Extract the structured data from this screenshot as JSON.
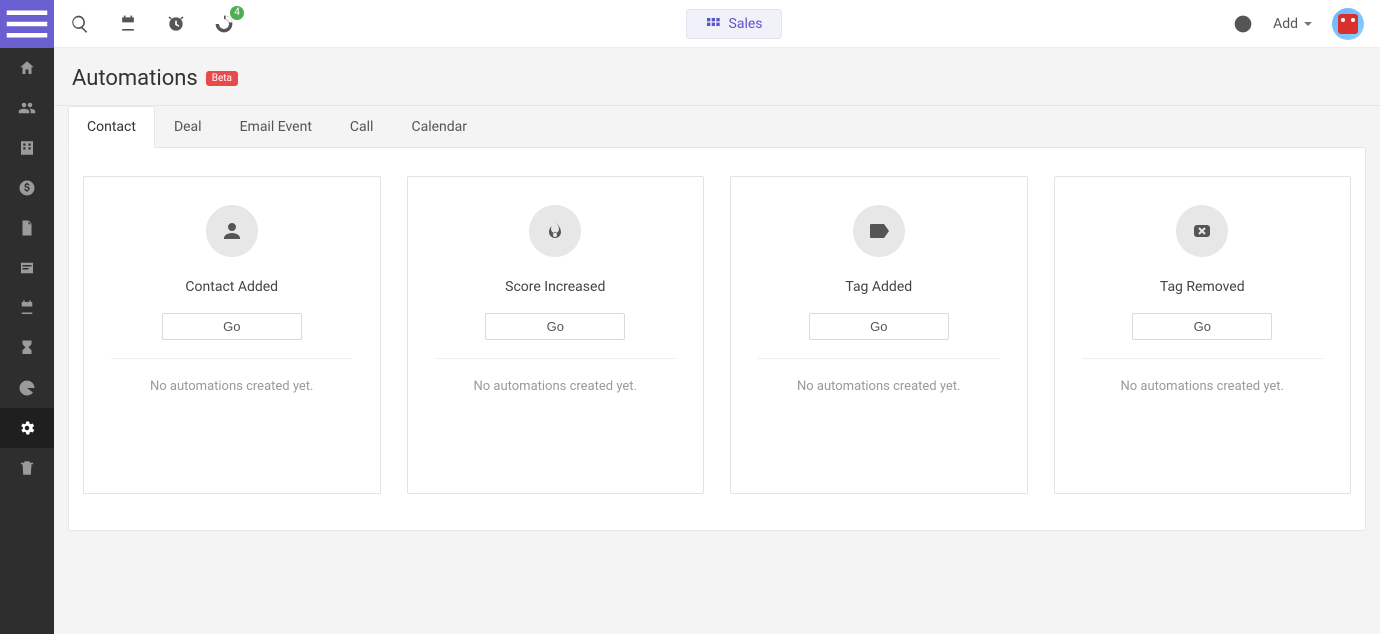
{
  "header": {
    "sales_label": "Sales",
    "add_label": "Add",
    "analytics_badge": "4"
  },
  "page": {
    "title": "Automations",
    "beta_label": "Beta"
  },
  "tabs": [
    {
      "label": "Contact"
    },
    {
      "label": "Deal"
    },
    {
      "label": "Email Event"
    },
    {
      "label": "Call"
    },
    {
      "label": "Calendar"
    }
  ],
  "cards": [
    {
      "title": "Contact Added",
      "go_label": "Go",
      "empty": "No automations created yet."
    },
    {
      "title": "Score Increased",
      "go_label": "Go",
      "empty": "No automations created yet."
    },
    {
      "title": "Tag Added",
      "go_label": "Go",
      "empty": "No automations created yet."
    },
    {
      "title": "Tag Removed",
      "go_label": "Go",
      "empty": "No automations created yet."
    }
  ]
}
